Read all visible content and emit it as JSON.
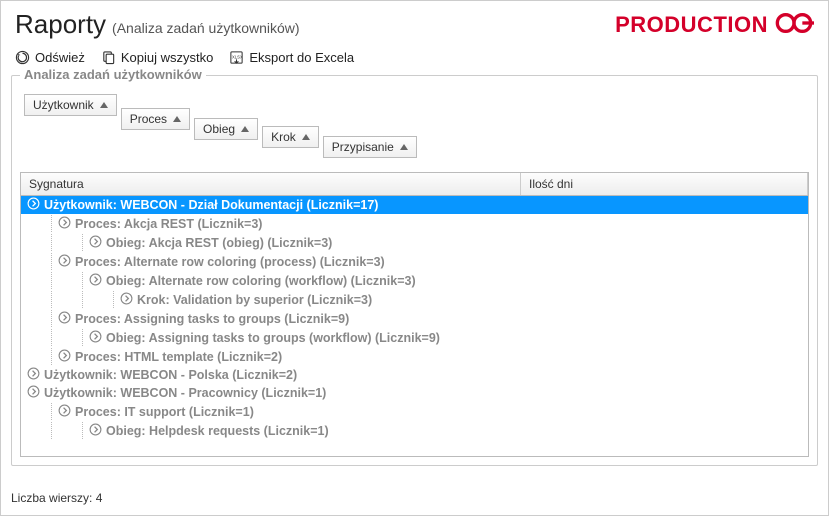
{
  "header": {
    "title": "Raporty",
    "subtitle": "(Analiza zadań użytkowników)",
    "brand": "PRODUCTION"
  },
  "toolbar": {
    "refresh": "Odśwież",
    "copy": "Kopiuj wszystko",
    "export": "Eksport do Excela"
  },
  "fieldset_title": "Analiza zadań użytkowników",
  "group_chips": [
    "Użytkownik",
    "Proces",
    "Obieg",
    "Krok",
    "Przypisanie"
  ],
  "columns": {
    "signature": "Sygnatura",
    "days": "Ilość dni"
  },
  "rows": [
    {
      "indent": 0,
      "text": "Użytkownik: WEBCON - Dział Dokumentacji (Licznik=17)",
      "selected": true
    },
    {
      "indent": 1,
      "text": "Proces: Akcja REST (Licznik=3)"
    },
    {
      "indent": 2,
      "text": "Obieg: Akcja REST (obieg) (Licznik=3)"
    },
    {
      "indent": 1,
      "text": "Proces: Alternate row coloring (process) (Licznik=3)"
    },
    {
      "indent": 2,
      "text": "Obieg: Alternate row coloring (workflow) (Licznik=3)"
    },
    {
      "indent": 3,
      "text": "Krok: Validation by superior (Licznik=3)"
    },
    {
      "indent": 1,
      "text": "Proces: Assigning tasks to groups (Licznik=9)"
    },
    {
      "indent": 2,
      "text": "Obieg: Assigning tasks to groups (workflow) (Licznik=9)"
    },
    {
      "indent": 1,
      "text": "Proces: HTML template (Licznik=2)"
    },
    {
      "indent": 0,
      "text": "Użytkownik: WEBCON - Polska (Licznik=2)"
    },
    {
      "indent": 0,
      "text": "Użytkownik: WEBCON - Pracownicy (Licznik=1)"
    },
    {
      "indent": 1,
      "text": "Proces: IT support (Licznik=1)"
    },
    {
      "indent": 2,
      "text": "Obieg: Helpdesk requests (Licznik=1)"
    }
  ],
  "footer": {
    "row_count_label": "Liczba wierszy:",
    "row_count": "4"
  }
}
